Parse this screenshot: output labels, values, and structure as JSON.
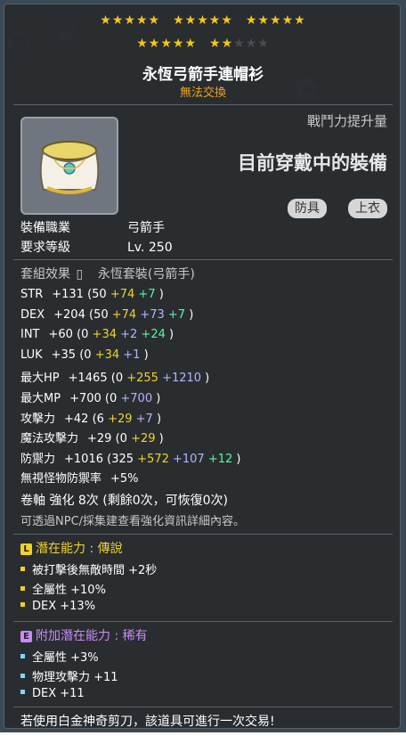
{
  "star_force": {
    "filled": 22,
    "total": 25
  },
  "item": {
    "name": "永恆弓箭手連帽衫",
    "trade": "無法交換",
    "icon": "hooded-shirt-icon"
  },
  "header": {
    "power_label": "戰鬥力提升量",
    "equipped_label": "目前穿戴中的裝備"
  },
  "tags": [
    "防具",
    "上衣"
  ],
  "req": {
    "job_label": "裝備職業",
    "job_value": "弓箭手",
    "level_label": "要求等級",
    "level_value": "Lv. 250"
  },
  "set": {
    "label": "套組效果",
    "value": "永恆套裝(弓箭手)",
    "icon": "mouse-icon"
  },
  "stats": [
    {
      "label": "STR",
      "total": "+131",
      "base": "(50",
      "parts": [
        {
          "t": "+74",
          "c": "y"
        },
        {
          "t": "+7",
          "c": "g"
        }
      ],
      "close": ")"
    },
    {
      "label": "DEX",
      "total": "+204",
      "base": "(50",
      "parts": [
        {
          "t": "+74",
          "c": "y"
        },
        {
          "t": "+73",
          "c": "p"
        },
        {
          "t": "+7",
          "c": "g"
        }
      ],
      "close": ")"
    },
    {
      "label": "INT",
      "total": "+60",
      "base": "(0",
      "parts": [
        {
          "t": "+34",
          "c": "y"
        },
        {
          "t": "+2",
          "c": "p"
        },
        {
          "t": "+24",
          "c": "g"
        }
      ],
      "close": ")"
    },
    {
      "label": "LUK",
      "total": "+35",
      "base": "(0",
      "parts": [
        {
          "t": "+34",
          "c": "y"
        },
        {
          "t": "+1",
          "c": "p"
        }
      ],
      "close": ")"
    },
    {
      "label": "最大HP",
      "total": "+1465",
      "base": "(0",
      "parts": [
        {
          "t": "+255",
          "c": "y"
        },
        {
          "t": "+1210",
          "c": "p"
        }
      ],
      "close": ")"
    },
    {
      "label": "最大MP",
      "total": "+700",
      "base": "(0",
      "parts": [
        {
          "t": "+700",
          "c": "p"
        }
      ],
      "close": ")"
    },
    {
      "label": "攻擊力",
      "total": "+42",
      "base": "(6",
      "parts": [
        {
          "t": "+29",
          "c": "y"
        },
        {
          "t": "+7",
          "c": "p"
        }
      ],
      "close": ")"
    },
    {
      "label": "魔法攻擊力",
      "total": "+29",
      "base": "(0",
      "parts": [
        {
          "t": "+29",
          "c": "y"
        }
      ],
      "close": ")"
    },
    {
      "label": "防禦力",
      "total": "+1016",
      "base": "(325",
      "parts": [
        {
          "t": "+572",
          "c": "y"
        },
        {
          "t": "+107",
          "c": "p"
        },
        {
          "t": "+12",
          "c": "g"
        }
      ],
      "close": ")"
    },
    {
      "label": "無視怪物防禦率",
      "total": "+5%",
      "base": "",
      "parts": [],
      "close": ""
    }
  ],
  "upgrade": {
    "text": "卷軸 強化 8次 (剩餘0次，可恢復0次)",
    "hint": "可透過NPC/採集建查看強化資訊詳細內容。"
  },
  "potential": {
    "badge": "L",
    "title": "潛在能力 : 傳說",
    "color": "#f0d22b",
    "lines": [
      "被打擊後無敵時間 +2秒",
      "全屬性 +10%",
      "DEX +13%"
    ]
  },
  "additional": {
    "badge": "E",
    "title": "附加潛在能力 : 稀有",
    "color": "#c98af5",
    "bullet": "#7fd8ff",
    "lines": [
      "全屬性 +3%",
      "物理攻擊力 +11",
      "DEX +11"
    ]
  },
  "footer": "若使用白金神奇剪刀，該道具可進行一次交易!"
}
